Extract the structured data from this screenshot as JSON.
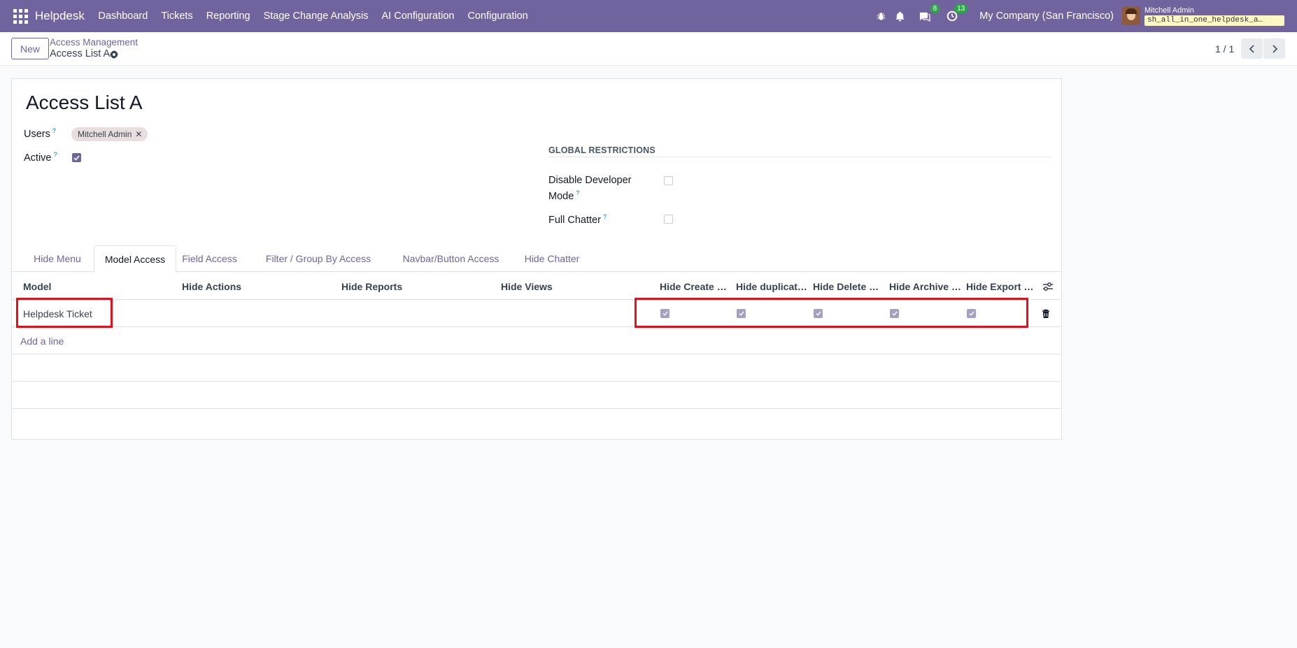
{
  "navbar": {
    "app_name": "Helpdesk",
    "menu": [
      "Dashboard",
      "Tickets",
      "Reporting",
      "Stage Change Analysis",
      "AI Configuration",
      "Configuration"
    ],
    "messages_count": "8",
    "activities_count": "13",
    "company": "My Company (San Francisco)",
    "user_name": "Mitchell Admin",
    "database": "sh_all_in_one_helpdesk_a…",
    "bg_color": "#71639e"
  },
  "control": {
    "new_label": "New",
    "breadcrumb_parent": "Access Management",
    "breadcrumb_current": "Access List A",
    "pager": "1 / 1"
  },
  "form": {
    "title": "Access List A",
    "users_label": "Users",
    "users_tag": "Mitchell Admin",
    "active_label": "Active",
    "active": true,
    "help_mark": "?",
    "global_title": "GLOBAL RESTRICTIONS",
    "disable_dev_label_1": "Disable Developer",
    "disable_dev_label_2": "Mode",
    "disable_dev": false,
    "full_chatter_label": "Full Chatter",
    "full_chatter": false
  },
  "tabs": [
    "Hide Menu",
    "Model Access",
    "Field Access",
    "Filter / Group By Access",
    "Navbar/Button Access",
    "Hide Chatter"
  ],
  "active_tab": "Model Access",
  "table": {
    "columns": [
      "Model",
      "Hide Actions",
      "Hide Reports",
      "Hide Views",
      "Hide Create …",
      "Hide duplicat…",
      "Hide Delete …",
      "Hide Archive …",
      "Hide Export …"
    ],
    "rows": [
      {
        "model": "Helpdesk Ticket",
        "hide_actions": "",
        "hide_reports": "",
        "hide_views": "",
        "hide_create": true,
        "hide_duplicate": true,
        "hide_delete": true,
        "hide_archive": true,
        "hide_export": true
      }
    ],
    "add_line": "Add a line"
  }
}
